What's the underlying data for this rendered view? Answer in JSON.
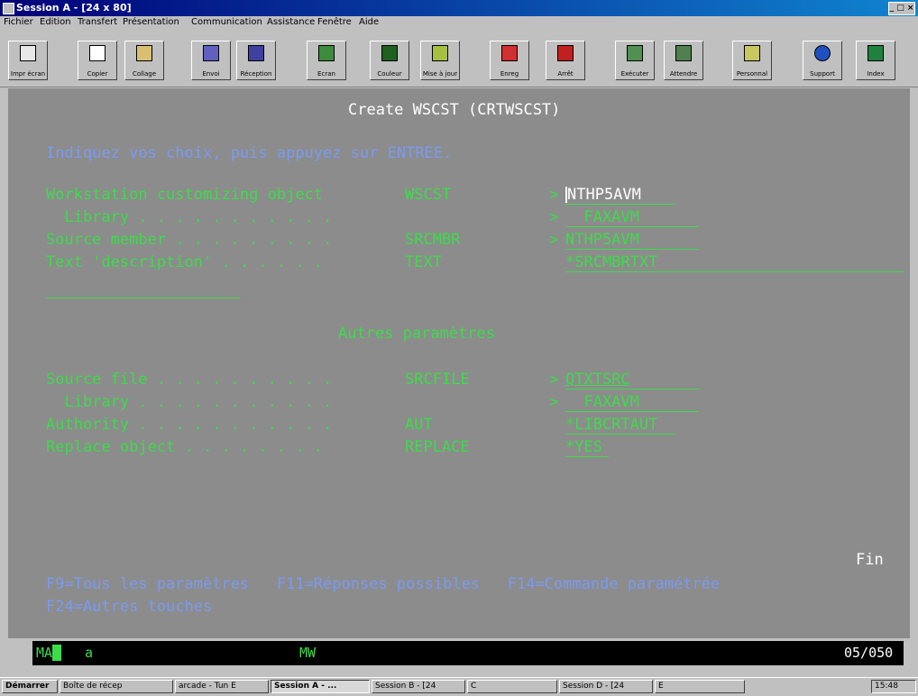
{
  "window": {
    "title": "Session A - [24 x 80]",
    "controls": "_ □ ×"
  },
  "menu": [
    "Fichier",
    "Edition",
    "Transfert",
    "Présentation",
    "Communication",
    "Assistance",
    "Fenêtre",
    "Aide"
  ],
  "toolbar": [
    {
      "label": "Impr écran",
      "icon": "print-icon"
    },
    {
      "label": "Copier",
      "icon": "copy-icon"
    },
    {
      "label": "Collage",
      "icon": "paste-icon"
    },
    {
      "label": "Envoi",
      "icon": "send-icon"
    },
    {
      "label": "Réception",
      "icon": "receive-icon"
    },
    {
      "label": "Ecran",
      "icon": "screen-icon"
    },
    {
      "label": "Couleur",
      "icon": "color-icon"
    },
    {
      "label": "Mise à jour",
      "icon": "edit-icon"
    },
    {
      "label": "Enreg",
      "icon": "record-icon"
    },
    {
      "label": "Arrêt",
      "icon": "stop-icon"
    },
    {
      "label": "Exécuter",
      "icon": "run-icon"
    },
    {
      "label": "Attendre",
      "icon": "wait-icon"
    },
    {
      "label": "Personnal",
      "icon": "customize-icon"
    },
    {
      "label": "Support",
      "icon": "globe-icon"
    },
    {
      "label": "Index",
      "icon": "book-icon"
    }
  ],
  "screen": {
    "title": "Create WSCST (CRTWSCST)",
    "instruction": "Indiquez vos choix, puis appuyez sur ENTREE.",
    "params": [
      {
        "label": "Workstation customizing object",
        "keyword": "WSCST",
        "marker": ">",
        "value": "NTHP5AVM"
      },
      {
        "label": "  Library . . . . . . . . . . .",
        "keyword": "",
        "marker": ">",
        "value": "  FAXAVM"
      },
      {
        "label": "Source member . . . . . . . . .",
        "keyword": "SRCMBR",
        "marker": ">",
        "value": "NTHP5AVM"
      },
      {
        "label": "Text 'description' . . . . . .",
        "keyword": "TEXT",
        "marker": "",
        "value": "*SRCMBRTXT"
      }
    ],
    "section_title": "Autres paramètres",
    "params2": [
      {
        "label": "Source file . . . . . . . . . .",
        "keyword": "SRCFILE",
        "marker": ">",
        "value": "QTXTSRC"
      },
      {
        "label": "  Library . . . . . . . . . . .",
        "keyword": "",
        "marker": ">",
        "value": "  FAXAVM"
      },
      {
        "label": "Authority . . . . . . . . . . .",
        "keyword": "AUT",
        "marker": "",
        "value": "*LIBCRTAUT"
      },
      {
        "label": "Replace object . . . . . . . .",
        "keyword": "REPLACE",
        "marker": "",
        "value": "*YES"
      }
    ],
    "fin": "Fin",
    "fkeys_line1": "F9=Tous les paramètres   F11=Réponses possibles   F14=Commande paramétrée",
    "fkeys_line2": "F24=Autres touches"
  },
  "oia": {
    "left": "MA",
    "mid1": "a",
    "mid2": "MW",
    "pos": "05/050"
  },
  "taskbar": {
    "start": "Démarrer",
    "items": [
      "Boîte de récep",
      "arcade - Tun E",
      "Session A - ...",
      "Session B - [24",
      "C",
      "Session D - [24",
      "E"
    ],
    "tray": "15:48"
  }
}
